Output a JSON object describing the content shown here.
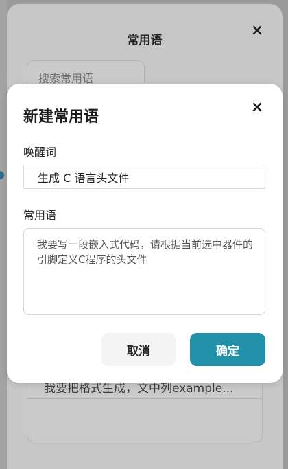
{
  "background_dialog": {
    "title": "常用语",
    "close_icon": "×",
    "search": {
      "placeholder": "搜索常用语"
    },
    "list": [
      {
        "text": "我要把格式生成，文中列example..."
      }
    ]
  },
  "new_phrase_dialog": {
    "title": "新建常用语",
    "close_icon": "×",
    "wake_word": {
      "label": "唤醒词",
      "value": "生成 C 语言头文件"
    },
    "phrase": {
      "label": "常用语",
      "value": "我要写一段嵌入式代码，请根据当前选中器件的引脚定义C程序的头文件"
    },
    "buttons": {
      "cancel": "取消",
      "confirm": "确定"
    }
  },
  "colors": {
    "confirm_button": "#2290a8",
    "overlay": "#9b9b9b"
  }
}
